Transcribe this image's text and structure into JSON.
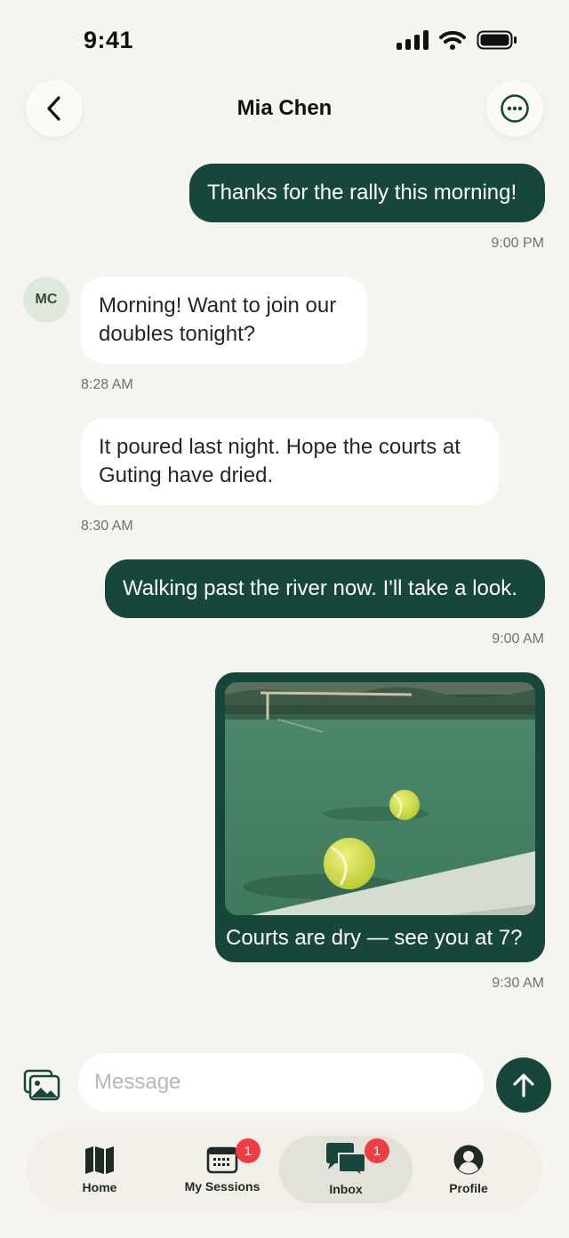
{
  "status_bar": {
    "time": "9:41"
  },
  "header": {
    "title": "Mia Chen"
  },
  "contact": {
    "initials": "MC"
  },
  "messages": [
    {
      "direction": "out",
      "text": "Thanks for the rally this morning!",
      "time": "9:00 PM"
    },
    {
      "direction": "in",
      "text": "Morning! Want to join our doubles tonight?",
      "time": "8:28 AM"
    },
    {
      "direction": "in",
      "text": "It poured last night. Hope the courts at Guting have dried.",
      "time": "8:30 AM"
    },
    {
      "direction": "out",
      "text": "Walking past the river now. I'll take a look.",
      "time": "9:00 AM"
    },
    {
      "direction": "out",
      "type": "photo",
      "image": "tennis-balls-on-court",
      "text": "Courts are dry — see you at 7?",
      "time": "9:30 AM"
    }
  ],
  "composer": {
    "placeholder": "Message"
  },
  "tabs": [
    {
      "label": "Home",
      "icon": "map-icon"
    },
    {
      "label": "My Sessions",
      "icon": "calendar-icon",
      "badge": "1"
    },
    {
      "label": "Inbox",
      "icon": "chat-icon",
      "badge": "1",
      "active": true
    },
    {
      "label": "Profile",
      "icon": "profile-icon"
    }
  ],
  "colors": {
    "accent": "#17463a",
    "background": "#f6f4ef",
    "badge": "#ef3d44"
  }
}
